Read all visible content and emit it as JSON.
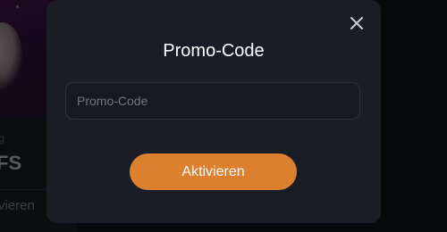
{
  "background": {
    "label_small": "g",
    "label_big": "FS",
    "link": "vieren"
  },
  "modal": {
    "title": "Promo-Code",
    "close_icon": "close-icon",
    "input": {
      "value": "",
      "placeholder": "Promo-Code"
    },
    "submit_label": "Aktivieren"
  },
  "colors": {
    "accent": "#dc7f2f",
    "modal_bg": "#1a1d26",
    "input_border": "#2c303b"
  }
}
